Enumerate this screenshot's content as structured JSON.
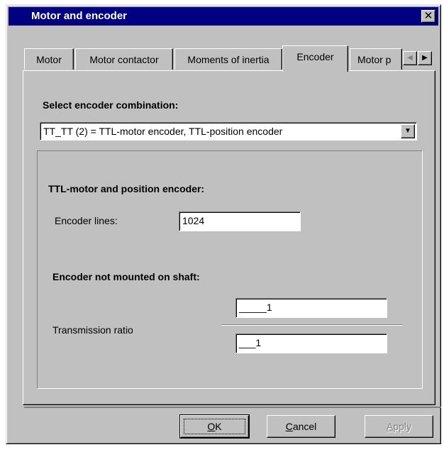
{
  "window": {
    "title": "Motor and encoder",
    "close_glyph": "✕"
  },
  "tabs": [
    {
      "label": "Motor",
      "active": false
    },
    {
      "label": "Motor contactor",
      "active": false
    },
    {
      "label": "Moments of inertia",
      "active": false
    },
    {
      "label": "Encoder",
      "active": true
    },
    {
      "label": "Motor p",
      "active": false
    }
  ],
  "tab_scroll": {
    "left_glyph": "◀",
    "right_glyph": "▶"
  },
  "encoder": {
    "select_label": "Select encoder combination:",
    "combination_value": "TT_TT (2) = TTL-motor encoder, TTL-position encoder",
    "dropdown_glyph": "▼",
    "group_heading": "TTL-motor and position encoder:",
    "encoder_lines_label": "Encoder lines:",
    "encoder_lines_value": "1024",
    "shaft_heading": "Encoder not mounted on shaft:",
    "transmission_label": "Transmission ratio",
    "numerator_value": "_____1",
    "denominator_value": "___1"
  },
  "buttons": {
    "ok_mnemonic": "O",
    "ok_rest": "K",
    "cancel_mnemonic": "C",
    "cancel_rest": "ancel",
    "apply_mnemonic": "A",
    "apply_rest": "pply"
  }
}
